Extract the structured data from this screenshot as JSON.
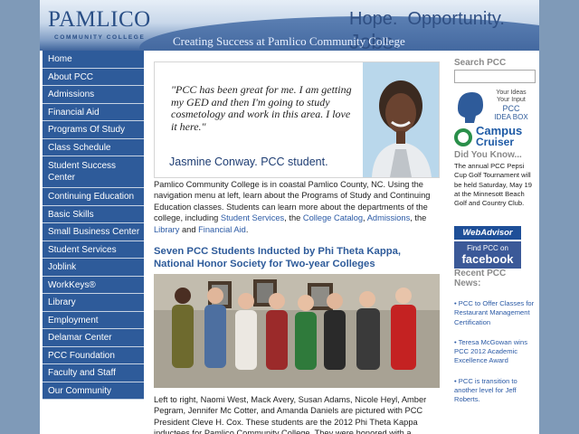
{
  "header": {
    "logo": "PAMLICO",
    "logo_sub": "COMMUNITY COLLEGE",
    "tagline_hope": "Hope.",
    "tagline_opportunity": "Opportunity.",
    "tagline_jobs": "Jobs.",
    "subtagline": "Creating Success at Pamlico Community College"
  },
  "nav": {
    "items": [
      {
        "label": "Home"
      },
      {
        "label": "About PCC"
      },
      {
        "label": "Admissions"
      },
      {
        "label": "Financial Aid"
      },
      {
        "label": "Programs Of Study"
      },
      {
        "label": "Class Schedule"
      },
      {
        "label": "Student Success Center"
      },
      {
        "label": "Continuing Education"
      },
      {
        "label": "Basic Skills"
      },
      {
        "label": "Small Business Center"
      },
      {
        "label": "Student Services"
      },
      {
        "label": "Joblink"
      },
      {
        "label": "WorkKeys®"
      },
      {
        "label": "Library"
      },
      {
        "label": "Employment"
      },
      {
        "label": "Delamar Center"
      },
      {
        "label": "PCC Foundation"
      },
      {
        "label": "Faculty and Staff"
      },
      {
        "label": "Our Community"
      }
    ]
  },
  "hero": {
    "quote": "\"PCC has been great for me.  I am getting my GED and then I'm going to study cosmetology and work in this area.  I love it here.\"",
    "name": "Jasmine Conway.  PCC student."
  },
  "intro": {
    "text1": "Pamlico Community College is in coastal Pamlico County, NC. Using the navigation menu at left, learn about the Programs of Study and Continuing Education classes. Students can learn more about the departments of the college, including ",
    "link1": "Student Services",
    "sep1": ", the ",
    "link2": "College Catalog",
    "sep2": ", ",
    "link3": "Admissions",
    "sep3": ", the ",
    "link4": "Library",
    "sep4": " and ",
    "link5": "Financial Aid",
    "end": "."
  },
  "story": {
    "title": "Seven PCC Students Inducted by Phi Theta Kappa, National Honor Society for Two-year Colleges",
    "caption": "Left to right, Naomi West, Mack Avery, Susan Adams, Nicole Heyl, Amber Pegram, Jennifer Mc Cotter, and Amanda Daniels are pictured with PCC President Cleve H. Cox. These students are the 2012 Phi Theta Kappa inductees for Pamlico Community College. They were honored with a"
  },
  "right": {
    "search_label": "Search PCC",
    "idea_line1": "Your Ideas",
    "idea_line2": "Your Input",
    "idea_line3": "PCC",
    "idea_line4": "IDEA BOX",
    "cruiser_line1": "Campus",
    "cruiser_line2": "Cruiser",
    "dyk_title": "Did You Know...",
    "dyk_text": "The annual PCC Pepsi Cup Golf Tournament will be held Saturday, May 19 at the Minnesott Beach Golf and Country Club.",
    "webadvisor": "WebAdvisor",
    "fb_line1": "Find PCC on",
    "fb_line2": "facebook",
    "recent_title": "Recent PCC News:",
    "news": [
      {
        "text": "• PCC to Offer Classes for Restaurant Management Certification"
      },
      {
        "text": "• Teresa McGowan wins PCC 2012 Academic Excellence Award"
      },
      {
        "text": "• PCC is transition to another level for Jeff Roberts."
      }
    ]
  },
  "colors": {
    "nav_bg": "#2e5b9a",
    "link": "#2b5aa5",
    "outer_bg": "#7f9ab8"
  }
}
